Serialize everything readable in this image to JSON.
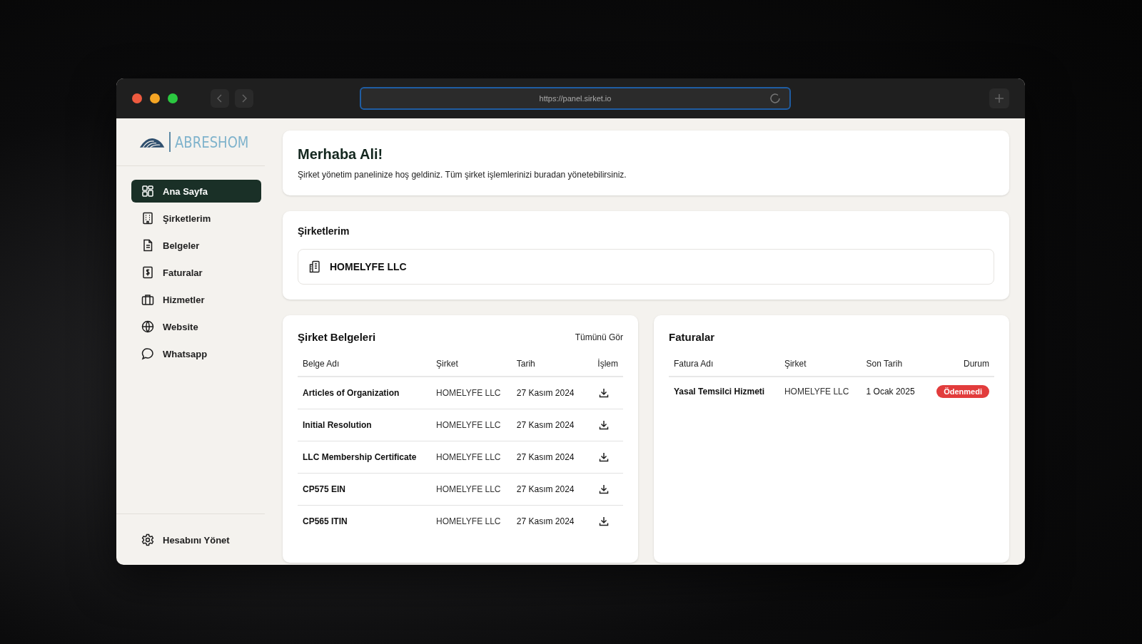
{
  "browser": {
    "url": "https://panel.sirket.io"
  },
  "sidebar": {
    "logo": "ABRESHOM",
    "items": [
      {
        "label": "Ana Sayfa",
        "selected": true
      },
      {
        "label": "Şirketlerim",
        "selected": false
      },
      {
        "label": "Belgeler",
        "selected": false
      },
      {
        "label": "Faturalar",
        "selected": false
      },
      {
        "label": "Hizmetler",
        "selected": false
      },
      {
        "label": "Website",
        "selected": false
      },
      {
        "label": "Whatsapp",
        "selected": false
      }
    ],
    "account": "Hesabını Yönet"
  },
  "welcome": {
    "title": "Merhaba Ali!",
    "text": "Şirket yönetim panelinize hoş geldiniz. Tüm şirket işlemlerinizi buradan yönetebilirsiniz."
  },
  "companies": {
    "title": "Şirketlerim",
    "items": [
      "HOMELYFE LLC"
    ]
  },
  "documents": {
    "title": "Şirket Belgeleri",
    "link": "Tümünü Gör",
    "columns": [
      "Belge Adı",
      "Şirket",
      "Tarih",
      "İşlem"
    ],
    "rows": [
      {
        "name": "Articles of Organization",
        "company": "HOMELYFE LLC",
        "date": "27 Kasım 2024"
      },
      {
        "name": "Initial Resolution",
        "company": "HOMELYFE LLC",
        "date": "27 Kasım 2024"
      },
      {
        "name": "LLC Membership Certificate",
        "company": "HOMELYFE LLC",
        "date": "27 Kasım 2024"
      },
      {
        "name": "CP575 EIN",
        "company": "HOMELYFE LLC",
        "date": "27 Kasım 2024"
      },
      {
        "name": "CP565 ITIN",
        "company": "HOMELYFE LLC",
        "date": "27 Kasım 2024"
      }
    ]
  },
  "invoices": {
    "title": "Faturalar",
    "columns": [
      "Fatura Adı",
      "Şirket",
      "Son Tarih",
      "Durum"
    ],
    "rows": [
      {
        "name": "Yasal Temsilci Hizmeti",
        "company": "HOMELYFE LLC",
        "due": "1 Ocak 2025",
        "status": {
          "label": "Ödenmedi",
          "kind": "unpaid"
        }
      }
    ]
  }
}
